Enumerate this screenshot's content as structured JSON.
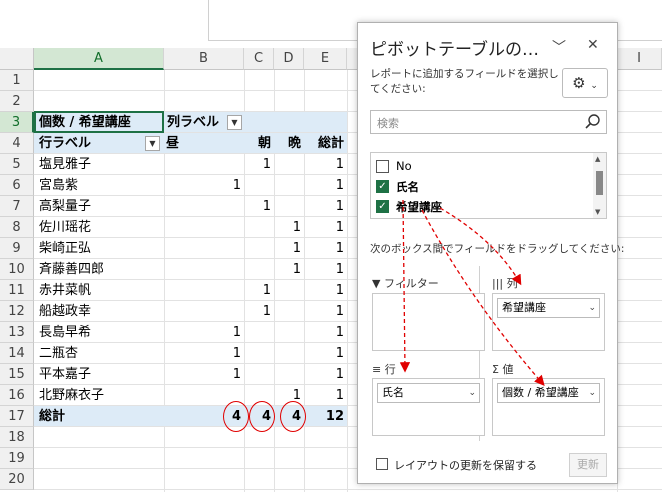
{
  "columns": [
    "A",
    "B",
    "C",
    "D",
    "E",
    "I"
  ],
  "rows": [
    "1",
    "2",
    "3",
    "4",
    "5",
    "6",
    "7",
    "8",
    "9",
    "10",
    "11",
    "12",
    "13",
    "14",
    "15",
    "16",
    "17",
    "18",
    "19",
    "20"
  ],
  "pivot": {
    "header": {
      "values_label": "個数 / 希望講座",
      "col_labels": "列ラベル"
    },
    "subheader": {
      "row_labels": "行ラベル",
      "c1": "昼",
      "c2": "朝",
      "c3": "晩",
      "c4": "総計"
    },
    "data": [
      {
        "name": "塩見雅子",
        "v": [
          "",
          "1",
          "",
          "1"
        ]
      },
      {
        "name": "宮島紫",
        "v": [
          "1",
          "",
          "",
          "1"
        ]
      },
      {
        "name": "高梨量子",
        "v": [
          "",
          "1",
          "",
          "1"
        ]
      },
      {
        "name": "佐川瑶花",
        "v": [
          "",
          "",
          "1",
          "1"
        ]
      },
      {
        "name": "柴崎正弘",
        "v": [
          "",
          "",
          "1",
          "1"
        ]
      },
      {
        "name": "斉藤善四郎",
        "v": [
          "",
          "",
          "1",
          "1"
        ]
      },
      {
        "name": "赤井菜帆",
        "v": [
          "",
          "1",
          "",
          "1"
        ]
      },
      {
        "name": "船越政幸",
        "v": [
          "",
          "1",
          "",
          "1"
        ]
      },
      {
        "name": "長島早希",
        "v": [
          "1",
          "",
          "",
          "1"
        ]
      },
      {
        "name": "二瓶杏",
        "v": [
          "1",
          "",
          "",
          "1"
        ]
      },
      {
        "name": "平本嘉子",
        "v": [
          "1",
          "",
          "",
          "1"
        ]
      },
      {
        "name": "北野麻衣子",
        "v": [
          "",
          "",
          "1",
          "1"
        ]
      }
    ],
    "total": {
      "label": "総計",
      "v": [
        "4",
        "4",
        "4",
        "12"
      ]
    }
  },
  "pane": {
    "title": "ピボットテーブルの…",
    "description": "レポートに追加するフィールドを選択してください:",
    "search_placeholder": "検索",
    "fields": [
      {
        "label": "No",
        "checked": false
      },
      {
        "label": "氏名",
        "checked": true
      },
      {
        "label": "希望講座",
        "checked": true
      }
    ],
    "instruction": "次のボックス間でフィールドをドラッグしてください:",
    "areas": {
      "filter": "フィルター",
      "columns": "列",
      "rows": "行",
      "values": "値"
    },
    "chips": {
      "columns": "希望講座",
      "rows": "氏名",
      "values": "個数 / 希望講座"
    },
    "defer_label": "レイアウトの更新を保留する",
    "update_label": "更新"
  },
  "colors": {
    "accent": "#1e7145",
    "pivot_band": "#ddebf7",
    "annotation": "#e00000"
  }
}
